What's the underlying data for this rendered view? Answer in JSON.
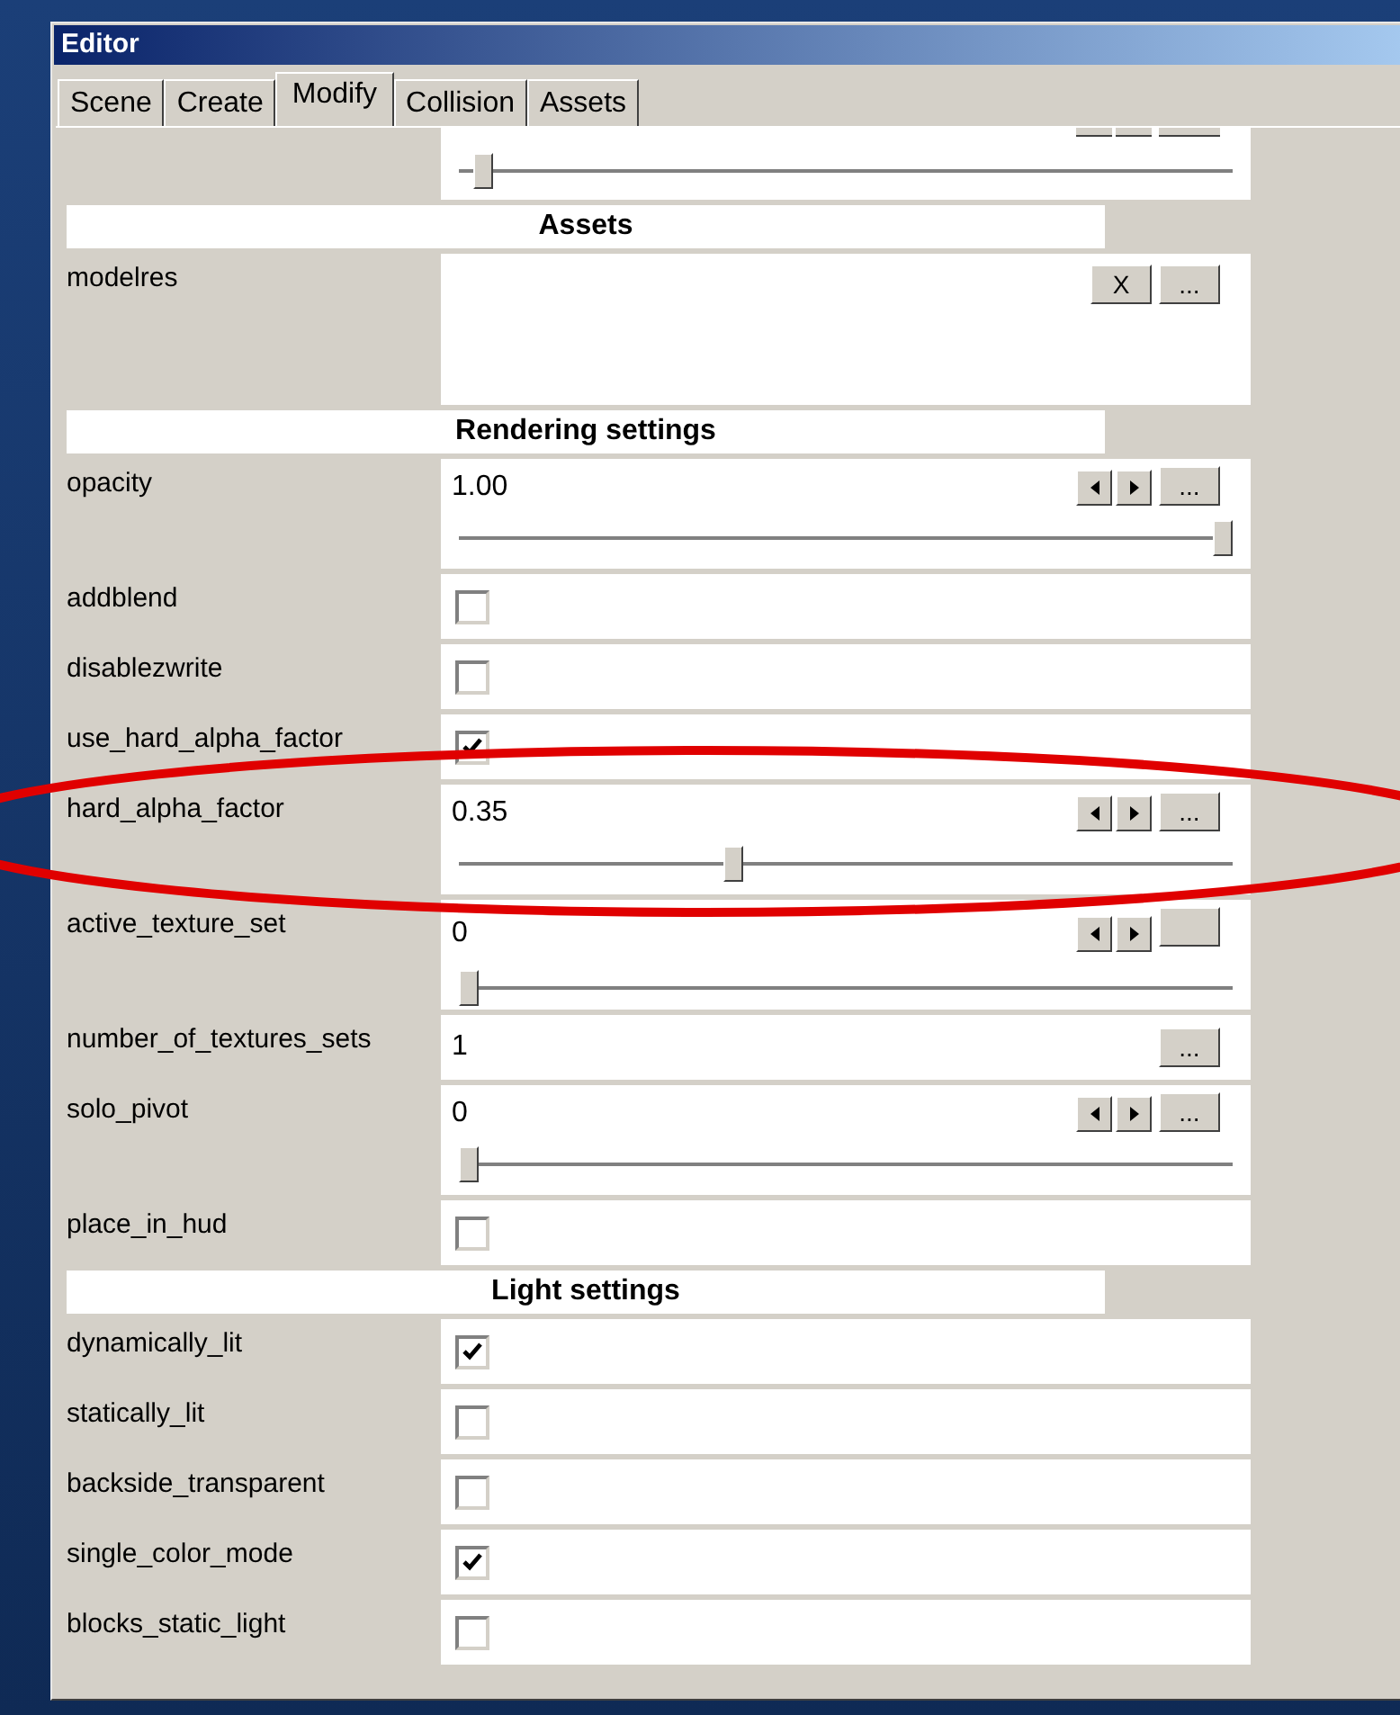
{
  "window": {
    "title": "Editor"
  },
  "tabs": [
    {
      "label": "Scene",
      "selected": false
    },
    {
      "label": "Create",
      "selected": false
    },
    {
      "label": "Modify",
      "selected": true
    },
    {
      "label": "Collision",
      "selected": false
    },
    {
      "label": "Assets",
      "selected": false
    }
  ],
  "rows": [
    {
      "kind": "slider_tail",
      "level": 0.02
    },
    {
      "kind": "header",
      "label": "Assets"
    },
    {
      "kind": "asset",
      "label": "modelres",
      "clear": "X",
      "browse": "..."
    },
    {
      "kind": "header",
      "label": "Rendering settings"
    },
    {
      "kind": "slider",
      "label": "opacity",
      "value": "1.00",
      "browse": "...",
      "level": 1
    },
    {
      "kind": "checkbox",
      "label": "addblend",
      "checked": false
    },
    {
      "kind": "checkbox",
      "label": "disablezwrite",
      "checked": false
    },
    {
      "kind": "checkbox",
      "label": "use_hard_alpha_factor",
      "checked": true
    },
    {
      "kind": "slider",
      "label": "hard_alpha_factor",
      "value": "0.35",
      "browse": "...",
      "level": 0.35
    },
    {
      "kind": "slider",
      "label": "active_texture_set",
      "value": "0",
      "browse": "",
      "level": 0
    },
    {
      "kind": "text",
      "label": "number_of_textures_sets",
      "value": "1",
      "browse": "..."
    },
    {
      "kind": "slider",
      "label": "solo_pivot",
      "value": "0",
      "browse": "...",
      "level": 0
    },
    {
      "kind": "checkbox",
      "label": "place_in_hud",
      "checked": false
    },
    {
      "kind": "header",
      "label": "Light settings"
    },
    {
      "kind": "checkbox",
      "label": "dynamically_lit",
      "checked": true
    },
    {
      "kind": "checkbox",
      "label": "statically_lit",
      "checked": false
    },
    {
      "kind": "checkbox",
      "label": "backside_transparent",
      "checked": false
    },
    {
      "kind": "checkbox",
      "label": "single_color_mode",
      "checked": true
    },
    {
      "kind": "checkbox",
      "label": "blocks_static_light",
      "checked": false
    }
  ]
}
